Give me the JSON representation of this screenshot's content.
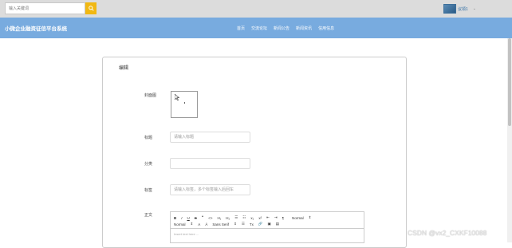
{
  "search": {
    "placeholder": "输入关键词"
  },
  "user": {
    "name": "议领1",
    "caret": "⌄"
  },
  "brand": "小微企业融资征信平台系统",
  "nav": [
    "首页",
    "交流论坛",
    "新闻公告",
    "新闻资讯",
    "信用信息"
  ],
  "form": {
    "title": "编辑",
    "cover_label": "封面图",
    "title_label": "标题",
    "title_placeholder": "请输入标题",
    "category_label": "分类",
    "category_value": "",
    "tags_label": "标签",
    "tags_placeholder": "请输入标签，多个标签输入后回车",
    "content_label": "正文"
  },
  "editor": {
    "row1": [
      "B",
      "I",
      "U",
      "S",
      "❞",
      "<>",
      "H₁",
      "H₂",
      "☰",
      "☷",
      "x₂",
      "x²",
      "⇤",
      "⇥",
      "¶",
      "Normal",
      "⇕"
    ],
    "row2": [
      "Normal",
      "⇕",
      "A",
      "Ā",
      "Sans Serif",
      "⇕",
      "☰",
      "Tx",
      "🔗",
      "▣",
      "▤"
    ],
    "placeholder": "Insert text here ..."
  },
  "watermark": "CSDN @vx2_CXKF10088"
}
